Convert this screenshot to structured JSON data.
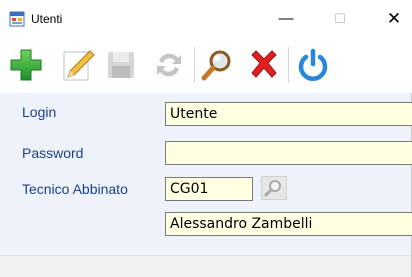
{
  "window": {
    "title": "Utenti",
    "minimize_glyph": "—",
    "maximize_glyph": "☐",
    "close_glyph": "✕"
  },
  "toolbar": {
    "icons": [
      "add-icon",
      "edit-icon",
      "save-icon",
      "refresh-icon",
      "search-icon",
      "delete-icon",
      "power-icon"
    ],
    "colors": {
      "add": "#2aa13c",
      "edit": "#e0b33a",
      "delete": "#e02020",
      "search": "#c8782a",
      "power": "#2a86d8",
      "disabled": "#c8c8c8"
    }
  },
  "form": {
    "login_label": "Login",
    "login_value": "Utente",
    "password_label": "Password",
    "password_value": "",
    "tecnico_label": "Tecnico Abbinato",
    "tecnico_code": "CG01",
    "tecnico_name": "Alessandro Zambelli"
  }
}
